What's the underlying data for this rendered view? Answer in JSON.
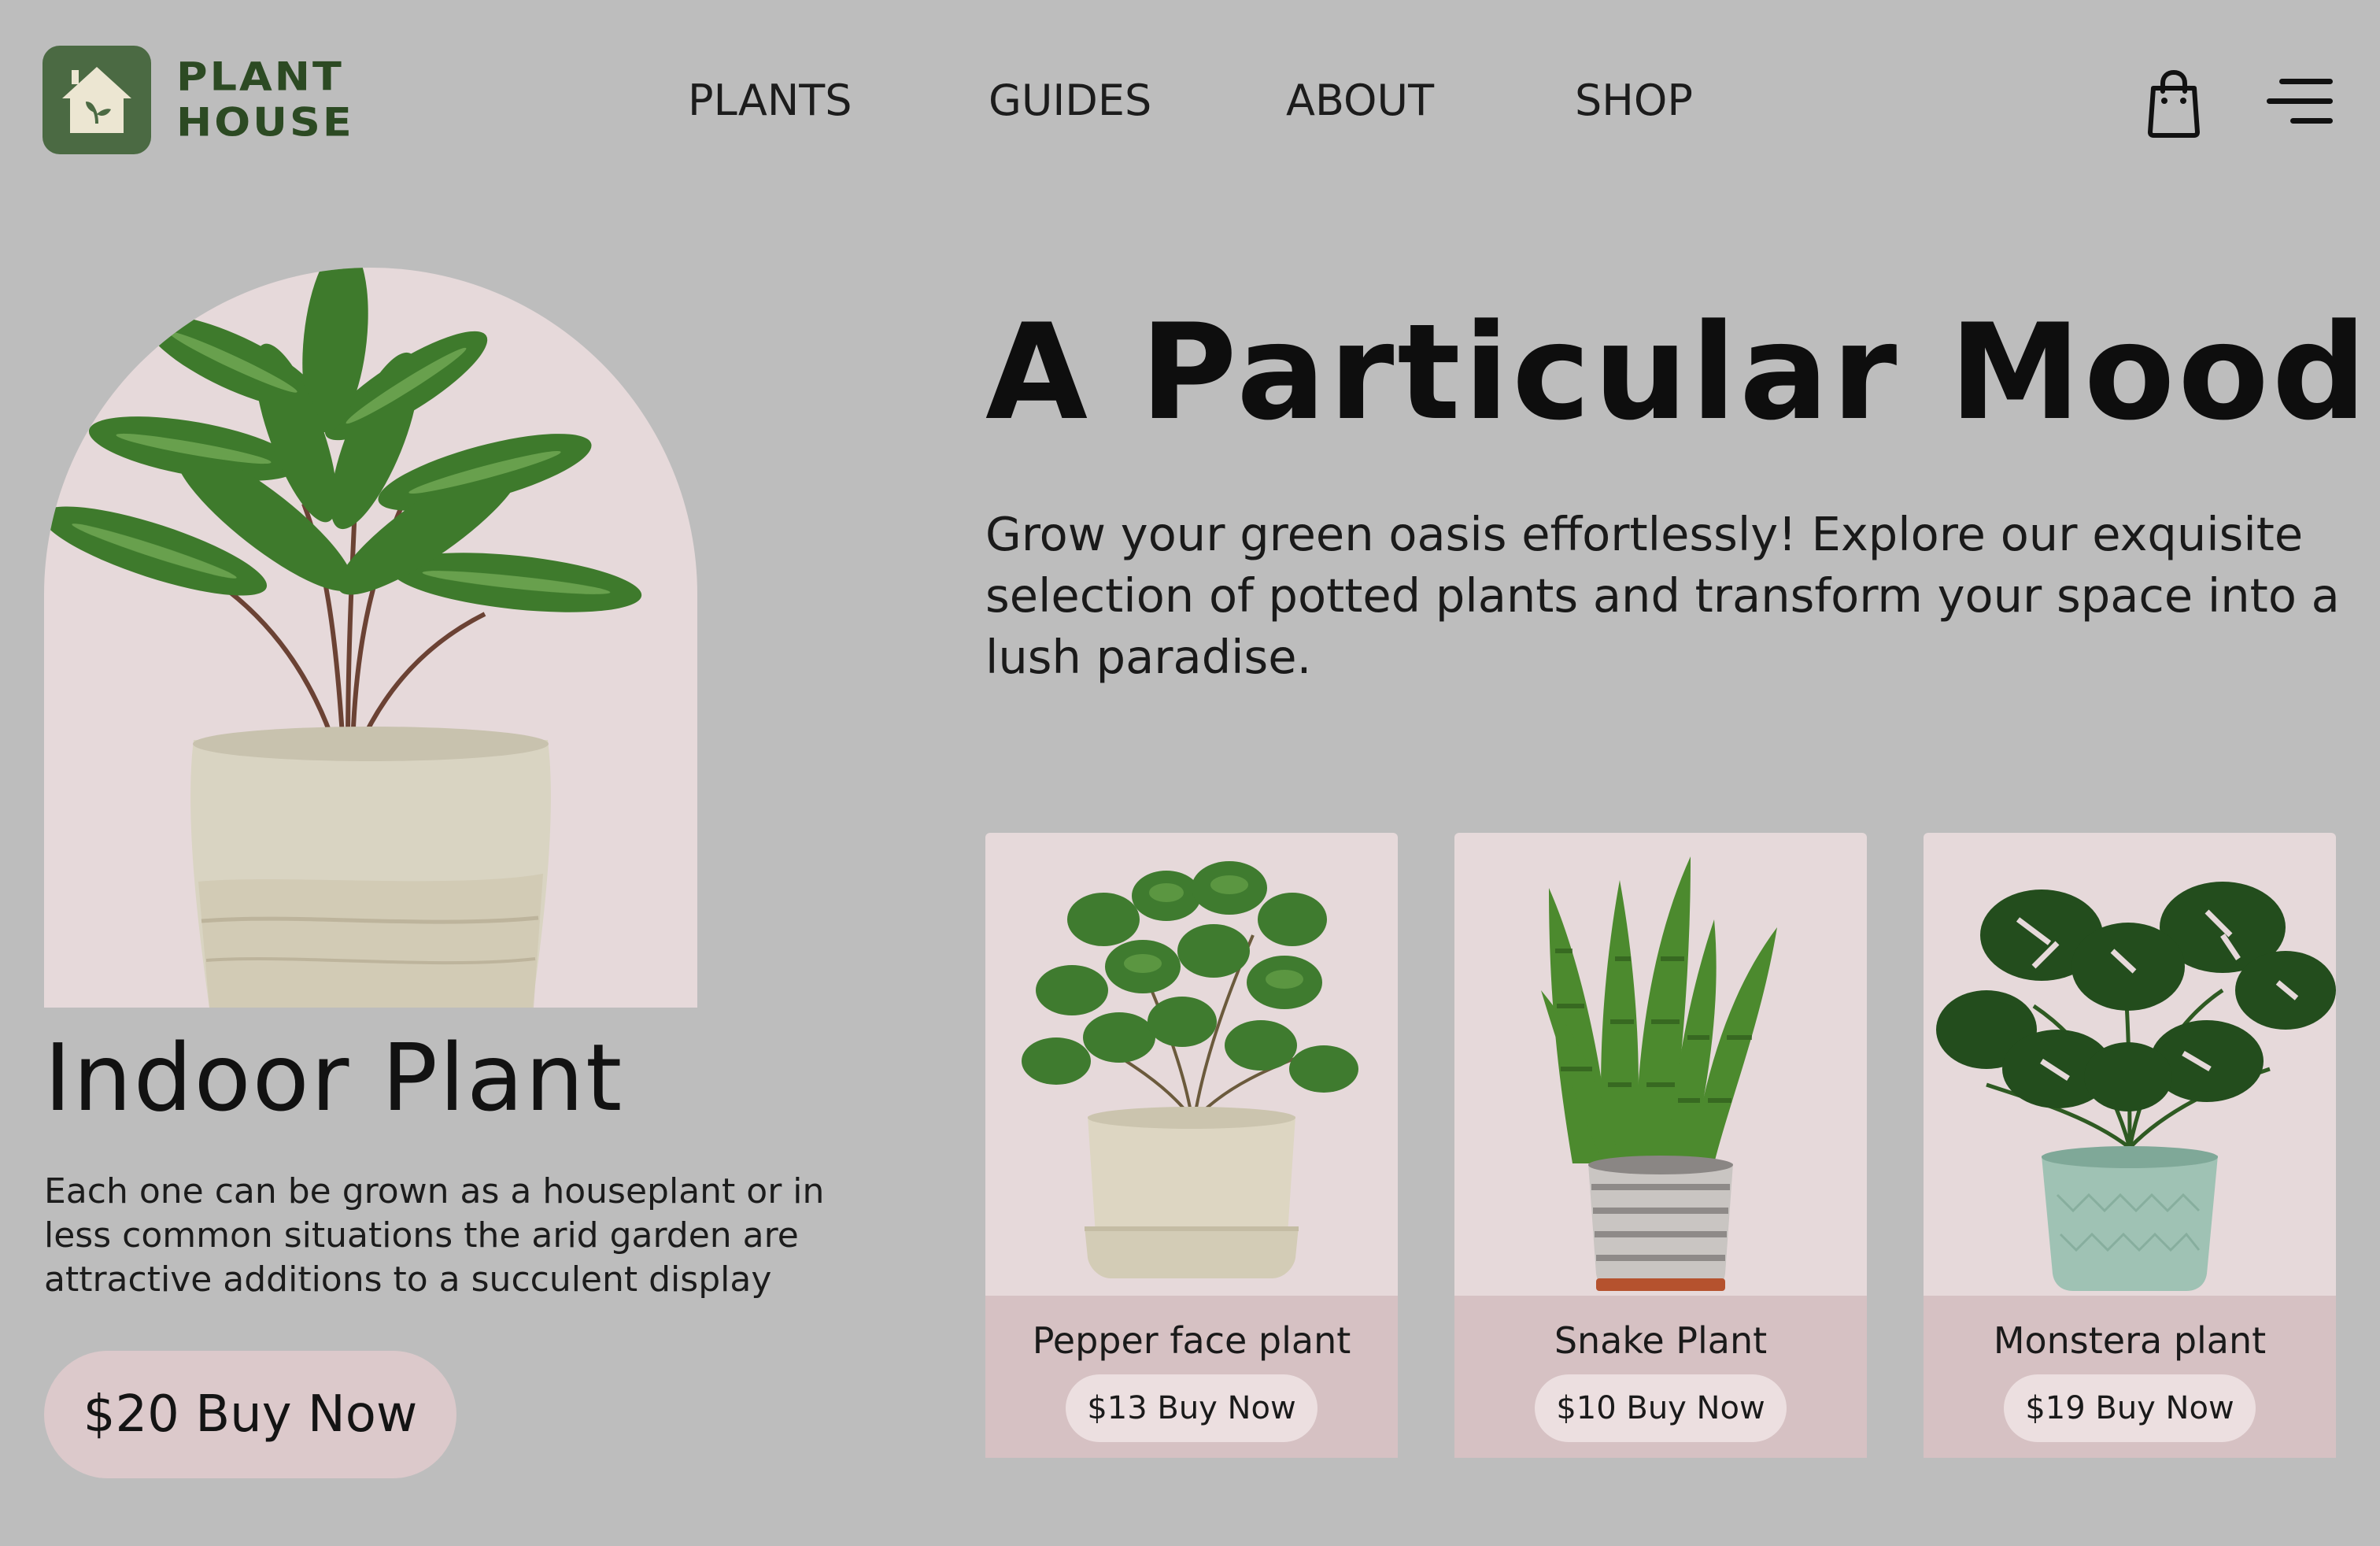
{
  "brand": {
    "line1": "PLANT",
    "line2": "HOUSE",
    "logo_icon": "house-sprout-icon",
    "color": "#4b6a43"
  },
  "nav": {
    "items": [
      {
        "label": "PLANTS"
      },
      {
        "label": "GUIDES"
      },
      {
        "label": "ABOUT"
      },
      {
        "label": "SHOP"
      }
    ],
    "cart_icon": "shopping-bag-icon",
    "menu_icon": "hamburger-menu-icon"
  },
  "feature": {
    "title": "Indoor Plant",
    "description": "Each one can be grown as a houseplant or in less common situations the arid garden are attractive additions to a succulent display",
    "button_label": "$20 Buy Now",
    "image": "calathea-in-stone-pot"
  },
  "hero": {
    "title": "A Particular Mood",
    "description": "Grow your green oasis effortlessly! Explore our exquisite selection of potted plants and transform your space into a lush paradise."
  },
  "products": [
    {
      "name": "Pepper face plant",
      "button_label": "$13 Buy Now",
      "image": "peperomia-in-beige-pot"
    },
    {
      "name": "Snake Plant",
      "button_label": "$10 Buy Now",
      "image": "sansevieria-in-striped-pot"
    },
    {
      "name": "Monstera plant",
      "button_label": "$19 Buy Now",
      "image": "monstera-in-mint-pot"
    }
  ],
  "colors": {
    "background": "#bdbdbd",
    "card": "#e6d9da",
    "card_footer": "#d6c1c3",
    "button": "#dcc9cb",
    "leaf": "#3e7a2c"
  }
}
